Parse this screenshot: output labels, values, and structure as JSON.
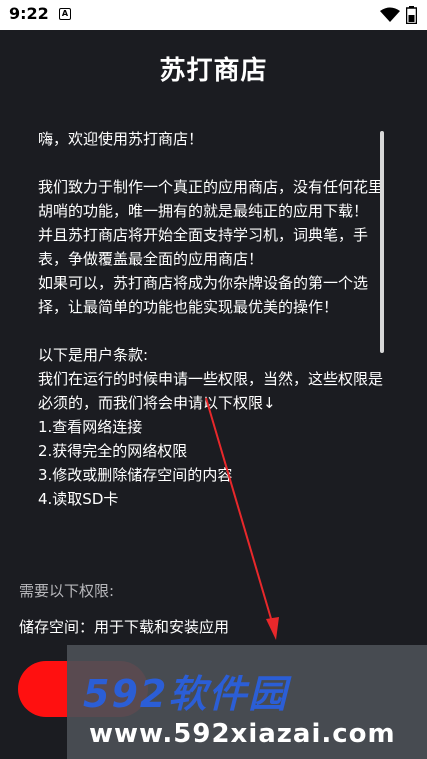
{
  "status_bar": {
    "time": "9:22",
    "app_icon_letter": "A"
  },
  "app": {
    "title": "苏打商店",
    "welcome_text": "嗨，欢迎使用苏打商店！\n\n我们致力于制作一个真正的应用商店，没有任何花里胡哨的功能，唯一拥有的就是最纯正的应用下载！\n并且苏打商店将开始全面支持学习机，词典笔，手表，争做覆盖最全面的应用商店！\n如果可以，苏打商店将成为你杂牌设备的第一个选择，让最简单的功能也能实现最优美的操作！\n\n以下是用户条款:\n我们在运行的时候申请一些权限，当然，这些权限是必须的，而我们将会申请以下权限↓\n1.查看网络连接\n2.获得完全的网络权限\n3.修改或删除储存空间的内容\n4.读取SD卡"
  },
  "permissions": {
    "heading": "需要以下权限:",
    "storage": "储存空间：用于下载和安装应用"
  },
  "watermark": {
    "brand": "592软件园",
    "url": "www.592xiazai.com"
  },
  "colors": {
    "background": "#1b1c21",
    "accent": "#ff1010",
    "annotation_arrow": "#e8282b"
  }
}
